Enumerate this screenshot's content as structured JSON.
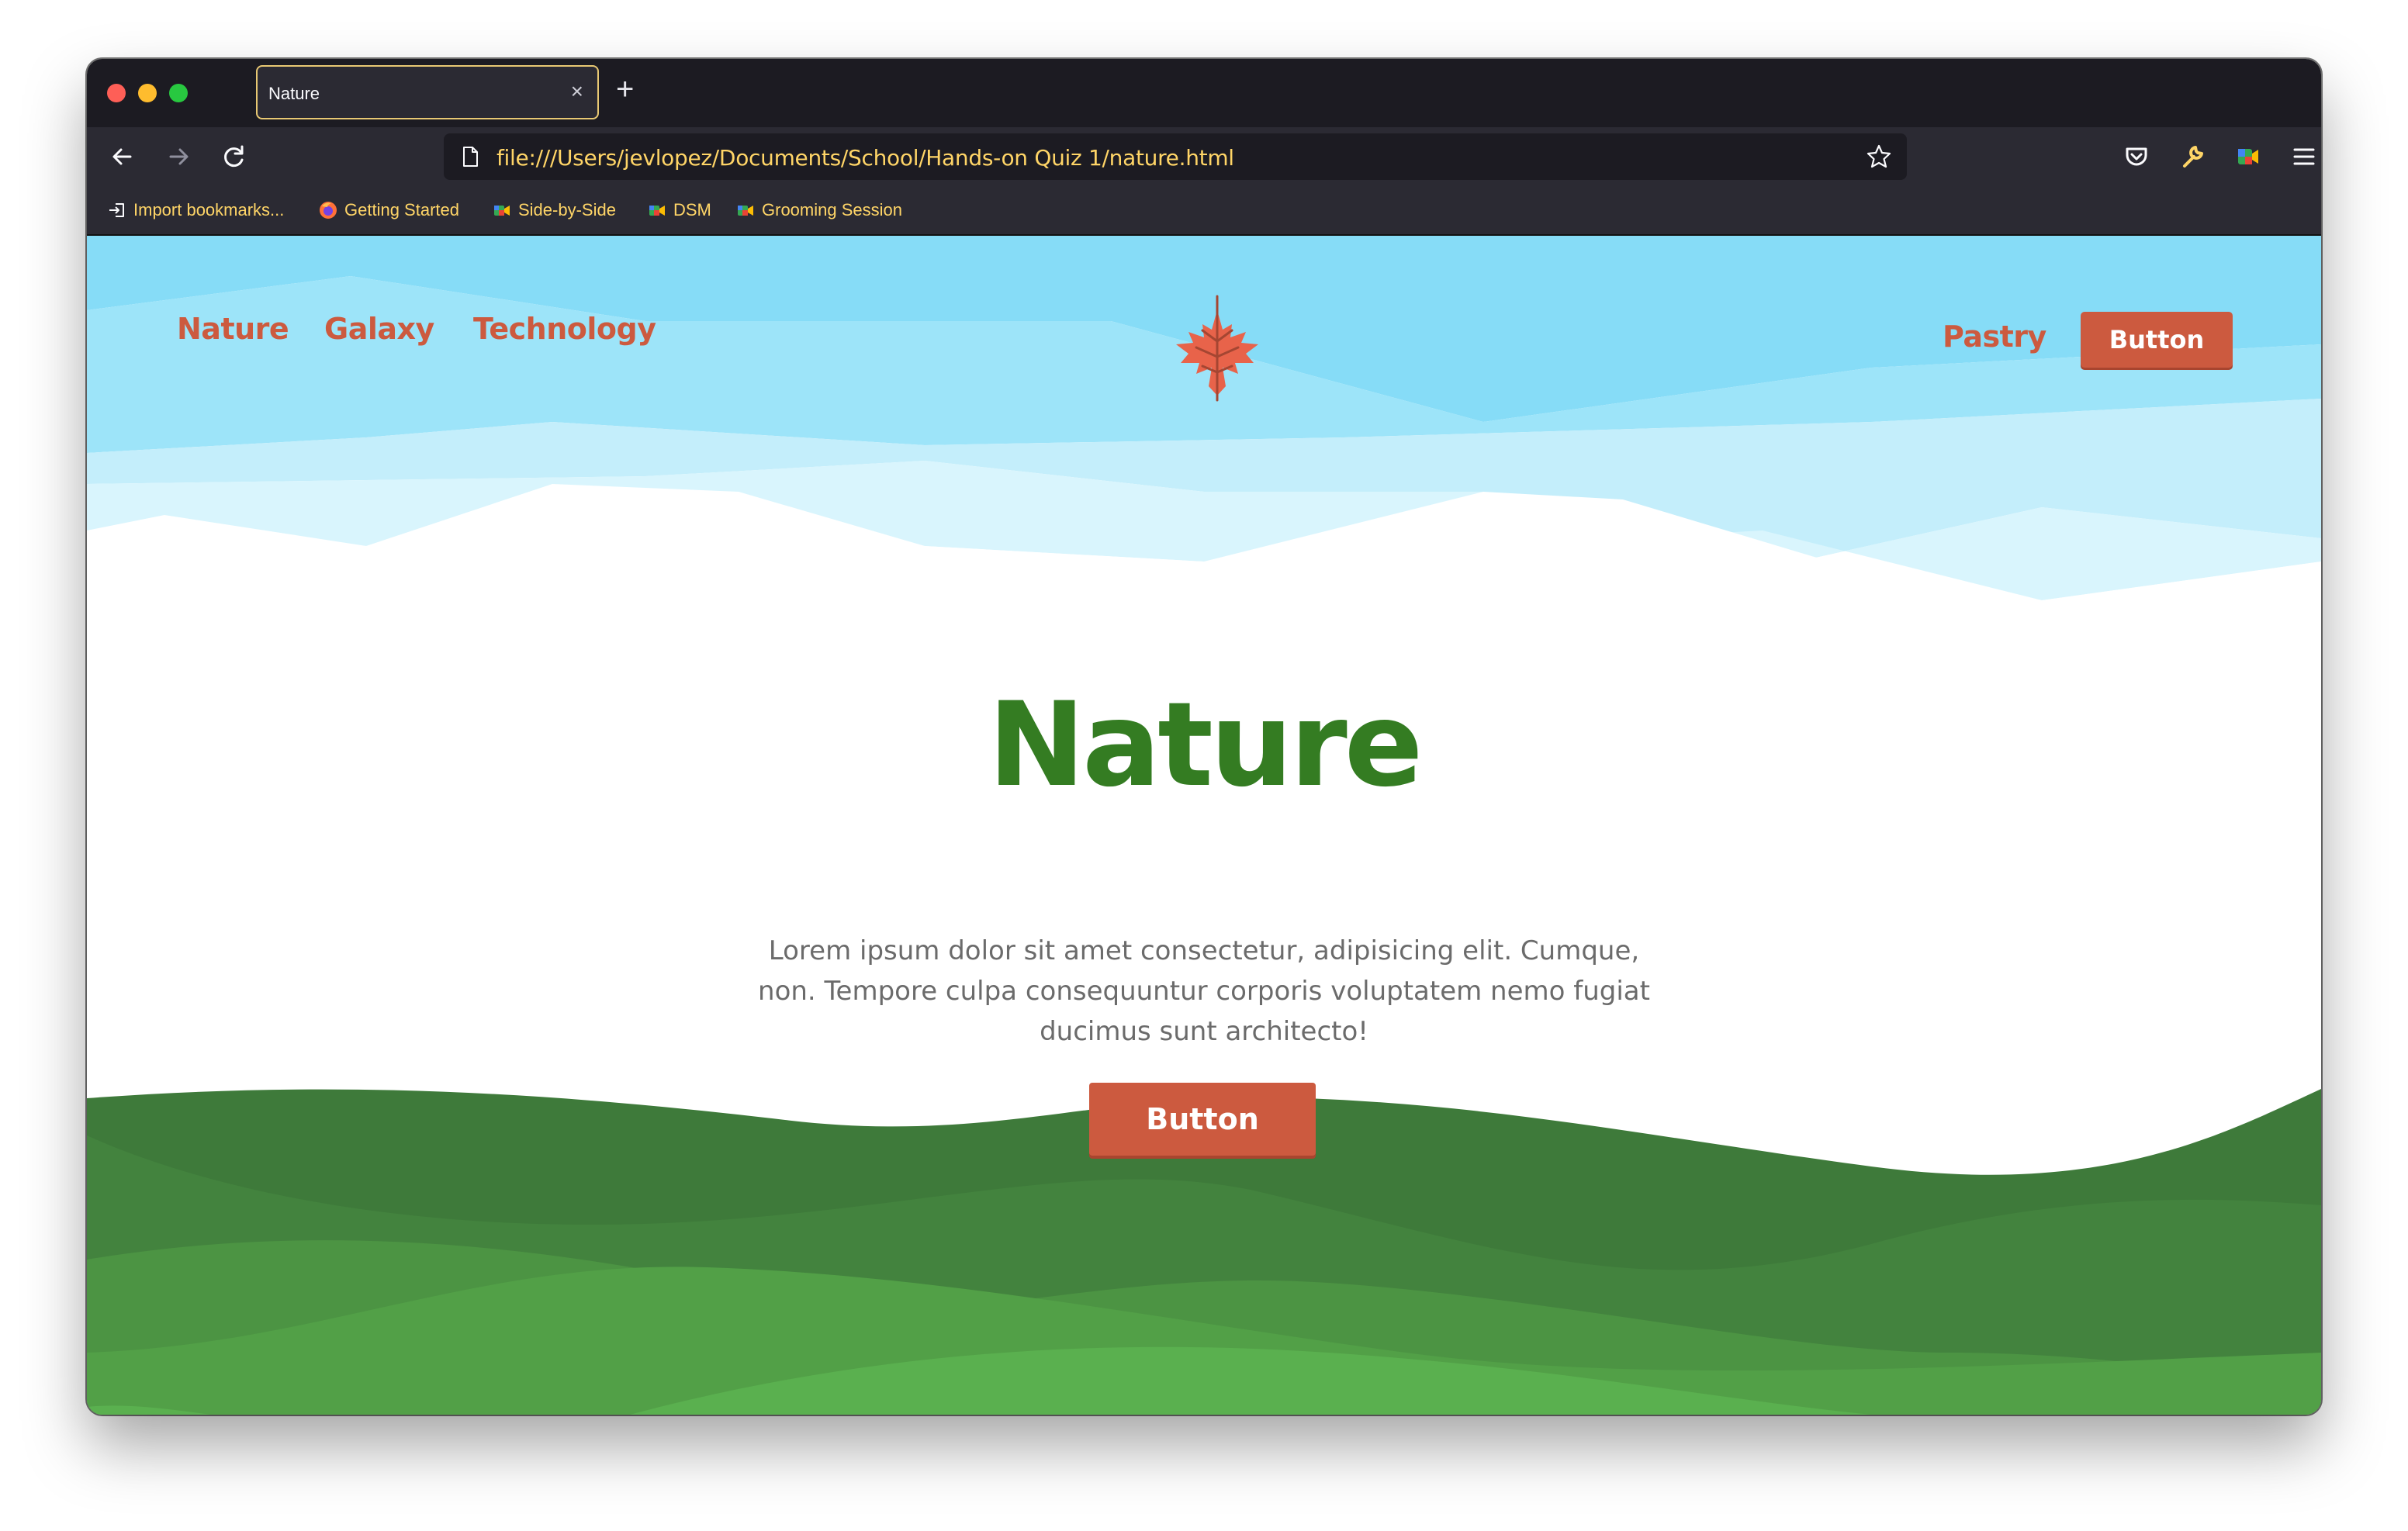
{
  "browser": {
    "tab_title": "Nature",
    "tab_close": "×",
    "new_tab": "+",
    "url": "file:///Users/jevlopez/Documents/School/Hands-on Quiz 1/nature.html",
    "bookmarks": [
      {
        "label": "Import bookmarks...",
        "icon": "import-icon"
      },
      {
        "label": "Getting Started",
        "icon": "firefox-icon"
      },
      {
        "label": "Side-by-Side",
        "icon": "meet-icon"
      },
      {
        "label": "DSM",
        "icon": "meet-icon"
      },
      {
        "label": "Grooming Session",
        "icon": "meet-icon"
      }
    ]
  },
  "site": {
    "nav_left": [
      "Nature",
      "Galaxy",
      "Technology"
    ],
    "nav_right_link": "Pastry",
    "nav_button": "Button",
    "logo_icon": "maple-leaf-icon",
    "hero_title": "Nature",
    "hero_text": "Lorem ipsum dolor sit amet consectetur, adipisicing elit. Cumque, non. Tempore culpa consequuntur corporis voluptatem nemo fugiat ducimus sunt architecto!",
    "hero_button": "Button"
  },
  "colors": {
    "accent": "#cc5a3f",
    "title_green": "#347c22",
    "sky": "#86dcf7",
    "hill_dark": "#3e7a3a",
    "hill_light": "#5ab04f"
  }
}
